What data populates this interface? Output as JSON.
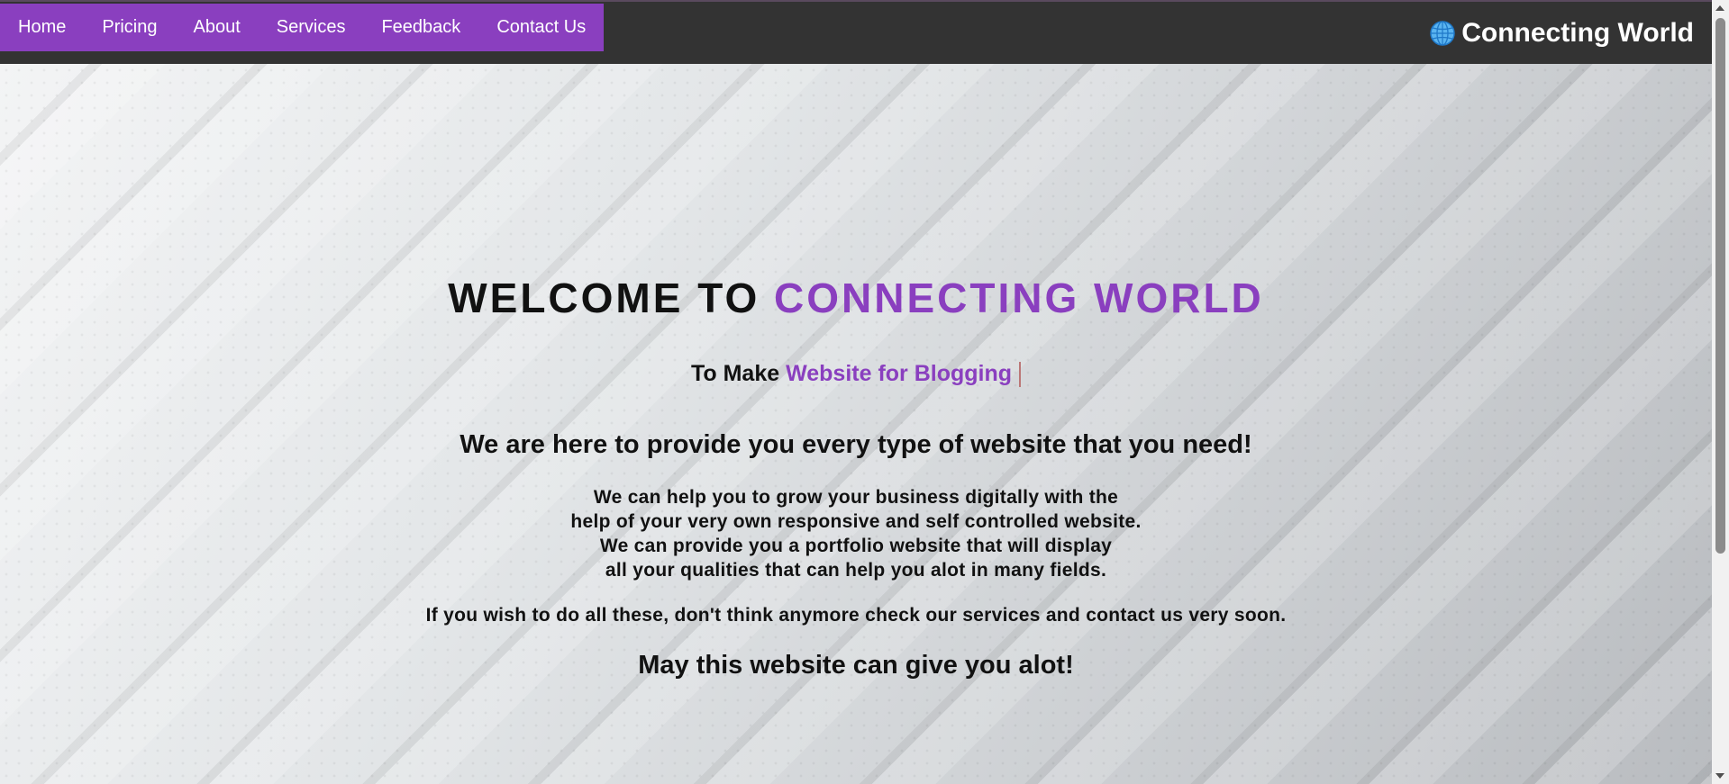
{
  "nav": {
    "items": [
      {
        "label": "Home"
      },
      {
        "label": "Pricing"
      },
      {
        "label": "About"
      },
      {
        "label": "Services"
      },
      {
        "label": "Feedback"
      },
      {
        "label": "Contact Us"
      }
    ]
  },
  "brand": {
    "icon": "globe-icon",
    "name": "Connecting World"
  },
  "hero": {
    "welcome_prefix": "WELCOME TO",
    "welcome_highlight": "CONNECTING WORLD",
    "tagline_prefix": "To Make",
    "tagline_highlight": "Website for Blogging",
    "subheading": "We are here to provide you every type of website that you need!",
    "paragraph_lines": [
      "We can help you to grow your business digitally with the",
      "help of your very own responsive and self controlled website.",
      "We can provide you a portfolio website that will display",
      "all your qualities that can help you alot in many fields."
    ],
    "wish": "If you wish to do all these, don't think anymore check our services and contact us very soon.",
    "closing": "May this website can give you alot!"
  },
  "colors": {
    "accent": "#8a3fbf",
    "topbar": "#333333",
    "text": "#111111"
  }
}
